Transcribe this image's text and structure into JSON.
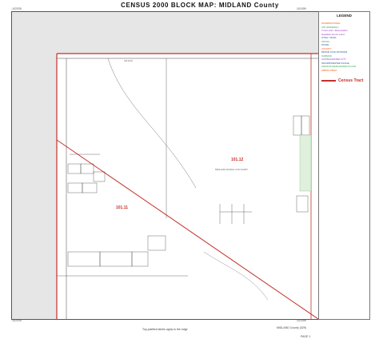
{
  "header": {
    "title": "CENSUS 2000 BLOCK MAP: MIDLAND County",
    "corner_top_left": "-102039",
    "corner_top_right": "-101059",
    "corner_bottom_left": "-102039",
    "corner_bottom_right": "-101059"
  },
  "map": {
    "tracts": [
      {
        "label": "101.11"
      },
      {
        "label": "101.12"
      }
    ],
    "place_label": "MIDLAND RURAL CCD 92057",
    "road_label_top": "CR1130",
    "colors": {
      "tract_boundary": "#c4302b",
      "roads": "#444444",
      "outside_area": "#e6e6e6",
      "water_hatch": "#6bb36b"
    }
  },
  "legend": {
    "title": "LEGEND",
    "rows": [
      {
        "text": "INTERNATIONAL",
        "style": "key"
      },
      {
        "text": "AIR (FEDERAL)",
        "style": "g"
      },
      {
        "text": "Trust Land / Reservation",
        "style": "p"
      },
      {
        "text": "Hawaiian Home Land",
        "style": "p"
      },
      {
        "text": "OTSA / TDSA",
        "style": "b"
      },
      {
        "text": "ANVSA",
        "style": "g"
      },
      {
        "text": "STATE",
        "style": "b"
      },
      {
        "text": "COUNTY",
        "style": "key"
      },
      {
        "text": "MINOR CIVIL DIVISION",
        "style": "b"
      },
      {
        "text": "SUBMCD",
        "style": "g"
      },
      {
        "text": "CONSOLIDATED CITY",
        "style": "p"
      },
      {
        "text": "INCORPORATED PLACE",
        "style": "b"
      },
      {
        "text": "CENSUS DESIGNATED PLACE",
        "style": "g"
      },
      {
        "text": "URBAN AREA",
        "style": "key"
      }
    ],
    "census_tract_label": "Census Tract"
  },
  "footer": {
    "scale_note": "Top-justified labels apply to the edge",
    "county_name": "MIDLAND County (329)",
    "sheet": "PAGE 1"
  }
}
